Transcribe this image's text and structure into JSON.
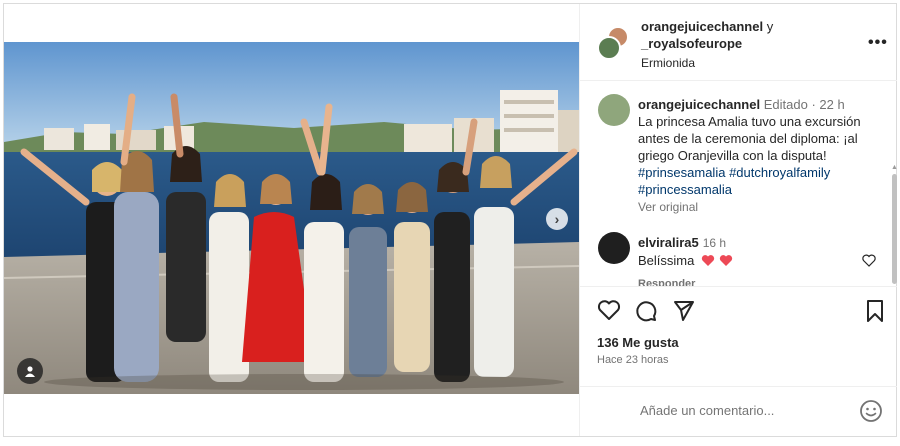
{
  "post": {
    "header": {
      "user1": "orangejuicechannel",
      "conjunction": "y",
      "user2": "_royalsofeurope",
      "location": "Ermionida",
      "more_icon": "more-horizontal-icon"
    },
    "caption": {
      "username": "orangejuicechannel",
      "edited": "Editado",
      "separator": "·",
      "time": "22 h",
      "text": "La princesa Amalia tuvo una excursión antes de la ceremonia del diploma: ¡al griego Oranjevilla con la disputa!",
      "hashtags": [
        "#prinsesamalia",
        "#dutchroyalfamily",
        "#princessamalia"
      ],
      "see_original": "Ver original"
    },
    "comment": {
      "username": "elviralira5",
      "time": "16 h",
      "text": "Belíssima",
      "emoji_icons": [
        "heart-emoji-icon",
        "heart-emoji-icon"
      ],
      "reply": "Responder"
    },
    "stats": {
      "likes": "136 Me gusta",
      "posted": "Hace 23 horas"
    },
    "add_comment": {
      "placeholder": "Añade un comentario..."
    },
    "icons": {
      "like": "heart-icon",
      "comment": "comment-icon",
      "share": "paper-plane-icon",
      "save": "bookmark-icon",
      "next": "chevron-right-icon",
      "tagged": "user-tag-icon",
      "emoji": "smiley-icon"
    },
    "colors": {
      "link": "#00376b",
      "muted": "#737373",
      "text": "#262626",
      "heart": "#ed4956"
    }
  }
}
